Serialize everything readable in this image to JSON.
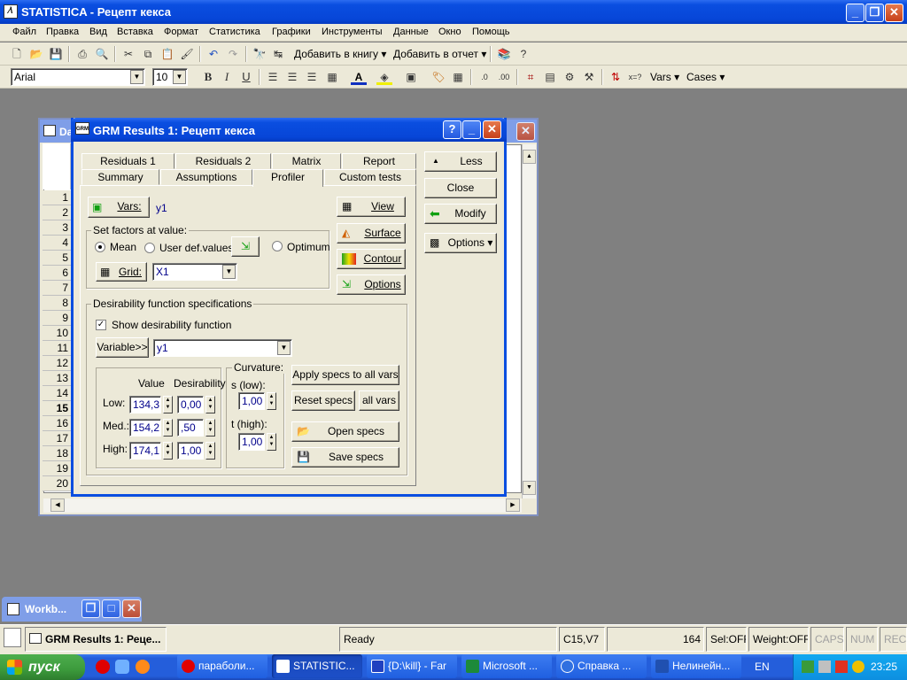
{
  "app": {
    "title": "STATISTICA - Рецепт кекса"
  },
  "menu": [
    "Файл",
    "Правка",
    "Вид",
    "Вставка",
    "Формат",
    "Статистика",
    "Графики",
    "Инструменты",
    "Данные",
    "Окно",
    "Помощь"
  ],
  "toolbar1": {
    "add_to_book": "Добавить в книгу",
    "add_to_report": "Добавить в отчет"
  },
  "toolbar2": {
    "font": "Arial",
    "size": "10",
    "vars": "Vars",
    "cases": "Cases"
  },
  "datawin": {
    "title_fragment": "Da",
    "rows": [
      "1",
      "2",
      "3",
      "4",
      "5",
      "6",
      "7",
      "8",
      "9",
      "10",
      "11",
      "12",
      "13",
      "14",
      "15",
      "16",
      "17",
      "18",
      "19",
      "20"
    ],
    "bold_row": "15"
  },
  "dialog": {
    "title": "GRM Results 1: Рецепт кекса",
    "help_label": "?",
    "tabs_back": [
      "Residuals 1",
      "Residuals 2",
      "Matrix",
      "Report"
    ],
    "tabs_front": [
      "Summary",
      "Assumptions",
      "Profiler",
      "Custom tests"
    ],
    "active_tab": "Profiler",
    "side": {
      "less": "Less",
      "close": "Close",
      "modify": "Modify",
      "options": "Options"
    },
    "vars_button": "Vars:",
    "vars_value": "y1",
    "set_factors": {
      "label": "Set factors at value:",
      "mean": "Mean",
      "user_def": "User def.values",
      "optimum": "Optimum",
      "grid": "Grid:",
      "grid_value": "X1"
    },
    "graph_buttons": {
      "view": "View",
      "surface": "Surface",
      "contour": "Contour",
      "options": "Options"
    },
    "desirability": {
      "label": "Desirability function specifications",
      "show": "Show desirability function",
      "show_checked": true,
      "variable_button": "Variable>>",
      "variable_value": "y1",
      "col_value": "Value",
      "col_desirability": "Desirability",
      "low_label": "Low:",
      "low_value": "134,3",
      "low_des": "0,00",
      "med_label": "Med.:",
      "med_value": "154,2",
      "med_des": ",50",
      "high_label": "High:",
      "high_value": "174,1",
      "high_des": "1,00",
      "curvature_label": "Curvature:",
      "s_low_label": "s (low):",
      "s_low": "1,00",
      "t_high_label": "t (high):",
      "t_high": "1,00",
      "apply_all": "Apply specs to all vars",
      "reset": "Reset specs",
      "all_vars": "all vars",
      "open": "Open specs",
      "save": "Save specs"
    }
  },
  "workbook": {
    "title": "Workb..."
  },
  "statusbar": {
    "task": "GRM Results 1: Реце...",
    "ready": "Ready",
    "cell": "C15,V7",
    "number": "164",
    "sel": "Sel:OFF",
    "weight": "Weight:OFF",
    "caps": "CAPS",
    "num": "NUM",
    "rec": "REC"
  },
  "taskbar": {
    "start": "пуск",
    "items": [
      "параболи...",
      "STATISTIC...",
      "{D:\\kill} - Far",
      "Microsoft ...",
      "Справка ...",
      "Нелинейн..."
    ],
    "lang": "EN",
    "clock": "23:25"
  },
  "colors": {
    "xp_blue": "#0a4ee0",
    "face": "#ece9d8",
    "desktop": "#808080",
    "taskbar": "#245edb",
    "start": "#3c9a3c"
  }
}
